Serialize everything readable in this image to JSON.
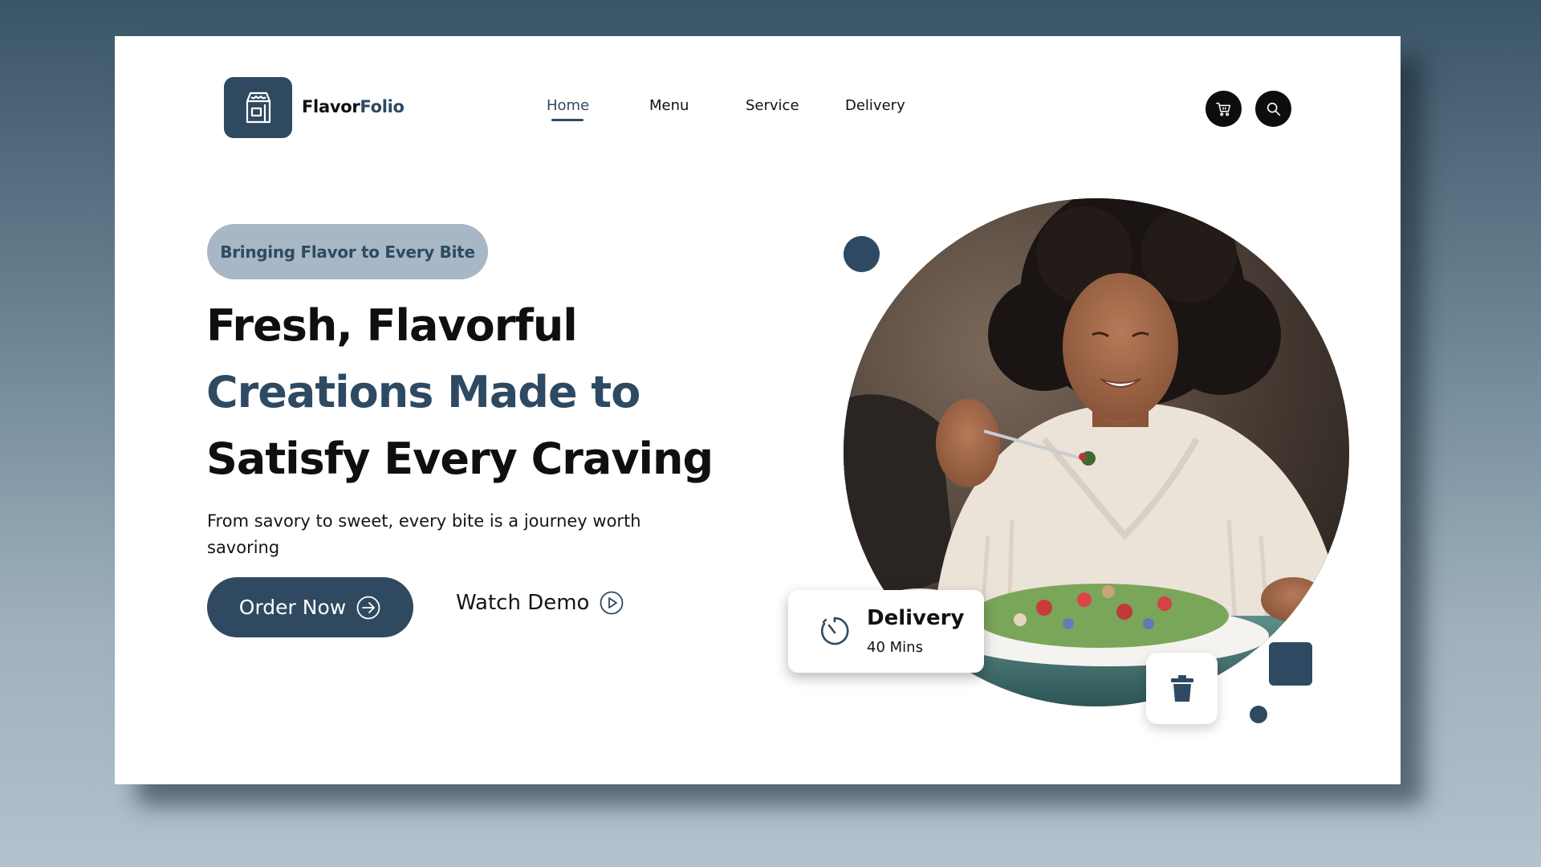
{
  "brand": {
    "name_part1": "Flavor",
    "name_part2": "Folio",
    "logo_icon": "shop-bag-icon"
  },
  "nav": {
    "items": [
      {
        "label": "Home",
        "active": true
      },
      {
        "label": "Menu",
        "active": false
      },
      {
        "label": "Service",
        "active": false
      },
      {
        "label": "Delivery",
        "active": false
      }
    ],
    "cart_icon": "cart-icon",
    "search_icon": "search-icon"
  },
  "hero": {
    "tagline": "Bringing Flavor to Every Bite",
    "headline_line1": "Fresh, Flavorful",
    "headline_line2": "Creations Made to",
    "headline_line3": "Satisfy Every Craving",
    "subtext": "From savory to sweet, every bite is a journey worth savoring",
    "order_button": "Order Now",
    "watch_demo": "Watch Demo"
  },
  "delivery_badge": {
    "title": "Delivery",
    "subtitle": "40 Mins",
    "icon": "timer-icon"
  },
  "trash_icon": "trash-icon",
  "colors": {
    "primary": "#2e4a63",
    "pill_bg": "#a7b7c5",
    "dark": "#0d0d0d",
    "white": "#ffffff"
  }
}
